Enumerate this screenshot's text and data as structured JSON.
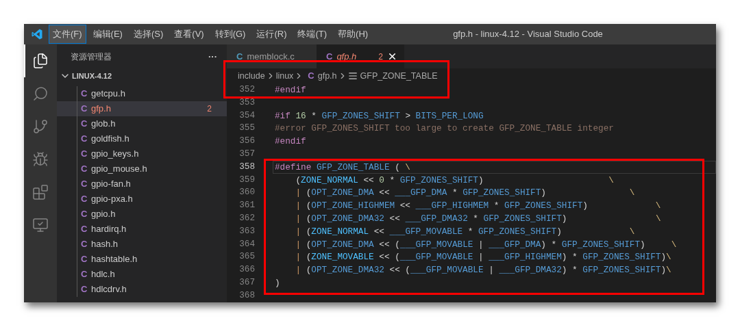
{
  "window": {
    "title": "gfp.h - linux-4.12 - Visual Studio Code"
  },
  "menu": [
    {
      "label": "文件(F)",
      "selected": true
    },
    {
      "label": "编辑(E)",
      "selected": false
    },
    {
      "label": "选择(S)",
      "selected": false
    },
    {
      "label": "查看(V)",
      "selected": false
    },
    {
      "label": "转到(G)",
      "selected": false
    },
    {
      "label": "运行(R)",
      "selected": false
    },
    {
      "label": "终端(T)",
      "selected": false
    },
    {
      "label": "帮助(H)",
      "selected": false
    }
  ],
  "activity_bar": [
    {
      "kind": "explorer",
      "selected": true
    },
    {
      "kind": "search",
      "selected": false
    },
    {
      "kind": "source_control",
      "selected": false
    },
    {
      "kind": "run",
      "selected": false
    },
    {
      "kind": "extensions",
      "selected": false
    },
    {
      "kind": "remote",
      "selected": false
    }
  ],
  "sidebar": {
    "title": "资源管理器",
    "more": "···",
    "folder": {
      "label": "LINUX-4.12",
      "expanded": true
    },
    "files": [
      {
        "icon": "C",
        "name": "getcpu.h",
        "selected": false,
        "problems": false
      },
      {
        "icon": "C",
        "name": "gfp.h",
        "selected": true,
        "problems": true,
        "badge": "2"
      },
      {
        "icon": "C",
        "name": "glob.h",
        "selected": false,
        "problems": false
      },
      {
        "icon": "C",
        "name": "goldfish.h",
        "selected": false,
        "problems": false
      },
      {
        "icon": "C",
        "name": "gpio_keys.h",
        "selected": false,
        "problems": false
      },
      {
        "icon": "C",
        "name": "gpio_mouse.h",
        "selected": false,
        "problems": false
      },
      {
        "icon": "C",
        "name": "gpio-fan.h",
        "selected": false,
        "problems": false
      },
      {
        "icon": "C",
        "name": "gpio-pxa.h",
        "selected": false,
        "problems": false
      },
      {
        "icon": "C",
        "name": "gpio.h",
        "selected": false,
        "problems": false
      },
      {
        "icon": "C",
        "name": "hardirq.h",
        "selected": false,
        "problems": false
      },
      {
        "icon": "C",
        "name": "hash.h",
        "selected": false,
        "problems": false
      },
      {
        "icon": "C",
        "name": "hashtable.h",
        "selected": false,
        "problems": false
      },
      {
        "icon": "C",
        "name": "hdlc.h",
        "selected": false,
        "problems": false
      },
      {
        "icon": "C",
        "name": "hdlcdrv.h",
        "selected": false,
        "problems": false
      }
    ]
  },
  "tabs": [
    {
      "icon": "C",
      "label": "memblock.c",
      "selected": false,
      "problems": false
    },
    {
      "icon": "C",
      "label": "gfp.h",
      "selected": true,
      "problems": true,
      "badge": "2"
    }
  ],
  "breadcrumb": [
    {
      "kind": "folder",
      "label": "include"
    },
    {
      "kind": "folder",
      "label": "linux"
    },
    {
      "kind": "file",
      "icon": "C",
      "label": "gfp.h"
    },
    {
      "kind": "symbol",
      "label": "GFP_ZONE_TABLE"
    }
  ],
  "editor": {
    "lines": [
      {
        "number": "352",
        "current": false,
        "tokens": [
          {
            "kind": "directive",
            "text": "#endif"
          }
        ]
      },
      {
        "number": "353",
        "current": false
      },
      {
        "number": "354",
        "current": false,
        "tokens": [
          {
            "kind": "directive",
            "text": "#if "
          },
          {
            "kind": "number",
            "text": "16"
          },
          {
            "kind": "plain",
            "text": " * "
          },
          {
            "kind": "macro",
            "text": "GFP_ZONES_SHIFT"
          },
          {
            "kind": "plain",
            "text": " > "
          },
          {
            "kind": "macro",
            "text": "BITS_PER_LONG"
          }
        ]
      },
      {
        "number": "355",
        "current": false,
        "tokens": [
          {
            "kind": "inactive",
            "text": "#error GFP_ZONES_SHIFT too large to create GFP_ZONE_TABLE integer"
          }
        ]
      },
      {
        "number": "356",
        "current": false,
        "tokens": [
          {
            "kind": "directive",
            "text": "#endif"
          }
        ]
      },
      {
        "number": "357",
        "current": false
      },
      {
        "number": "358",
        "current": true,
        "tokens": [
          {
            "kind": "directive",
            "text": "#define "
          },
          {
            "kind": "macro",
            "text": "GFP_ZONE_TABLE"
          },
          {
            "kind": "plain",
            "text": " ( "
          },
          {
            "kind": "escape",
            "text": "\\"
          }
        ]
      },
      {
        "number": "359",
        "current": false,
        "tokens": [
          {
            "kind": "plain",
            "text": "    ("
          },
          {
            "kind": "constant",
            "text": "ZONE_NORMAL"
          },
          {
            "kind": "plain",
            "text": " << "
          },
          {
            "kind": "number",
            "text": "0"
          },
          {
            "kind": "plain",
            "text": " * "
          },
          {
            "kind": "macro",
            "text": "GFP_ZONES_SHIFT"
          },
          {
            "kind": "plain",
            "text": ")                        "
          },
          {
            "kind": "escape",
            "text": "\\"
          }
        ]
      },
      {
        "number": "360",
        "current": false,
        "tokens": [
          {
            "kind": "pipe",
            "text": "    |"
          },
          {
            "kind": "plain",
            "text": " ("
          },
          {
            "kind": "macro",
            "text": "OPT_ZONE_DMA"
          },
          {
            "kind": "plain",
            "text": " << "
          },
          {
            "kind": "macro",
            "text": "___GFP_DMA"
          },
          {
            "kind": "plain",
            "text": " * "
          },
          {
            "kind": "macro",
            "text": "GFP_ZONES_SHIFT"
          },
          {
            "kind": "plain",
            "text": ")                "
          },
          {
            "kind": "escape",
            "text": "\\"
          }
        ]
      },
      {
        "number": "361",
        "current": false,
        "tokens": [
          {
            "kind": "pipe",
            "text": "    |"
          },
          {
            "kind": "plain",
            "text": " ("
          },
          {
            "kind": "macro",
            "text": "OPT_ZONE_HIGHMEM"
          },
          {
            "kind": "plain",
            "text": " << "
          },
          {
            "kind": "macro",
            "text": "___GFP_HIGHMEM"
          },
          {
            "kind": "plain",
            "text": " * "
          },
          {
            "kind": "macro",
            "text": "GFP_ZONES_SHIFT"
          },
          {
            "kind": "plain",
            "text": ")             "
          },
          {
            "kind": "escape",
            "text": "\\"
          }
        ]
      },
      {
        "number": "362",
        "current": false,
        "tokens": [
          {
            "kind": "pipe",
            "text": "    |"
          },
          {
            "kind": "plain",
            "text": " ("
          },
          {
            "kind": "macro",
            "text": "OPT_ZONE_DMA32"
          },
          {
            "kind": "plain",
            "text": " << "
          },
          {
            "kind": "macro",
            "text": "___GFP_DMA32"
          },
          {
            "kind": "plain",
            "text": " * "
          },
          {
            "kind": "macro",
            "text": "GFP_ZONES_SHIFT"
          },
          {
            "kind": "plain",
            "text": ")                 "
          },
          {
            "kind": "escape",
            "text": "\\"
          }
        ]
      },
      {
        "number": "363",
        "current": false,
        "tokens": [
          {
            "kind": "pipe",
            "text": "    |"
          },
          {
            "kind": "plain",
            "text": " ("
          },
          {
            "kind": "constant",
            "text": "ZONE_NORMAL"
          },
          {
            "kind": "plain",
            "text": " << "
          },
          {
            "kind": "macro",
            "text": "___GFP_MOVABLE"
          },
          {
            "kind": "plain",
            "text": " * "
          },
          {
            "kind": "macro",
            "text": "GFP_ZONES_SHIFT"
          },
          {
            "kind": "plain",
            "text": ")             "
          },
          {
            "kind": "escape",
            "text": "\\"
          }
        ]
      },
      {
        "number": "364",
        "current": false,
        "tokens": [
          {
            "kind": "pipe",
            "text": "    |"
          },
          {
            "kind": "plain",
            "text": " ("
          },
          {
            "kind": "macro",
            "text": "OPT_ZONE_DMA"
          },
          {
            "kind": "plain",
            "text": " << ("
          },
          {
            "kind": "macro",
            "text": "___GFP_MOVABLE"
          },
          {
            "kind": "plain",
            "text": " | "
          },
          {
            "kind": "macro",
            "text": "___GFP_DMA"
          },
          {
            "kind": "plain",
            "text": ") * "
          },
          {
            "kind": "macro",
            "text": "GFP_ZONES_SHIFT"
          },
          {
            "kind": "plain",
            "text": ")     "
          },
          {
            "kind": "escape",
            "text": "\\"
          }
        ]
      },
      {
        "number": "365",
        "current": false,
        "tokens": [
          {
            "kind": "pipe",
            "text": "    |"
          },
          {
            "kind": "plain",
            "text": " ("
          },
          {
            "kind": "constant",
            "text": "ZONE_MOVABLE"
          },
          {
            "kind": "plain",
            "text": " << ("
          },
          {
            "kind": "macro",
            "text": "___GFP_MOVABLE"
          },
          {
            "kind": "plain",
            "text": " | "
          },
          {
            "kind": "macro",
            "text": "___GFP_HIGHMEM"
          },
          {
            "kind": "plain",
            "text": ") * "
          },
          {
            "kind": "macro",
            "text": "GFP_ZONES_SHIFT"
          },
          {
            "kind": "plain",
            "text": ")"
          },
          {
            "kind": "escape",
            "text": "\\"
          }
        ]
      },
      {
        "number": "366",
        "current": false,
        "tokens": [
          {
            "kind": "pipe",
            "text": "    |"
          },
          {
            "kind": "plain",
            "text": " ("
          },
          {
            "kind": "macro",
            "text": "OPT_ZONE_DMA32"
          },
          {
            "kind": "plain",
            "text": " << ("
          },
          {
            "kind": "macro",
            "text": "___GFP_MOVABLE"
          },
          {
            "kind": "plain",
            "text": " | "
          },
          {
            "kind": "macro",
            "text": "___GFP_DMA32"
          },
          {
            "kind": "plain",
            "text": ") * "
          },
          {
            "kind": "macro",
            "text": "GFP_ZONES_SHIFT"
          },
          {
            "kind": "plain",
            "text": ")"
          },
          {
            "kind": "escape",
            "text": "\\"
          }
        ]
      },
      {
        "number": "367",
        "current": false,
        "tokens": [
          {
            "kind": "plain",
            "text": ")"
          }
        ]
      },
      {
        "number": "368",
        "current": false
      }
    ]
  }
}
